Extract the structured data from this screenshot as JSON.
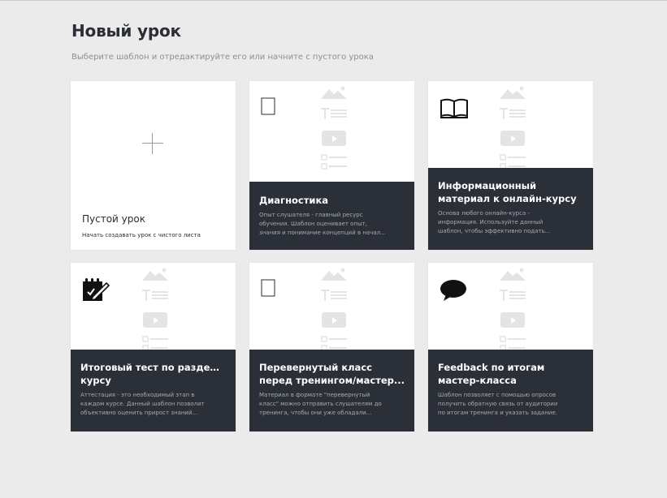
{
  "page": {
    "title": "Новый урок",
    "subtitle": "Выберите шаблон и отредактируйте его или начните с пустого урока"
  },
  "blank_card": {
    "title": "Пустой урок",
    "description": "Начать создавать урок с чистого листа",
    "icon": "plus-icon"
  },
  "templates": [
    {
      "title_lines": [
        "Диагностика"
      ],
      "description_lines": [
        "Опыт слушателя - главный ресурс",
        "обучения. Шаблон оценивает опыт,",
        "знания и понимание концепций в начал..."
      ],
      "icon": "blank-page-icon"
    },
    {
      "title_lines": [
        "Информационный",
        "материал к онлайн-курсу"
      ],
      "description_lines": [
        "Основа любого онлайн-курса -",
        "информация. Используйте данный",
        "шаблон, чтобы эффективно подать..."
      ],
      "icon": "open-book-icon"
    },
    {
      "title_lines": [
        "Итоговый тест по разделу/",
        "курсу"
      ],
      "description_lines": [
        "Аттестация - это необходимый этап в",
        "каждом курсе. Данный шаблон позволит",
        "объективно оценить прирост знаний..."
      ],
      "icon": "test-notepad-icon"
    },
    {
      "title_lines": [
        "Перевернутый класс",
        "перед тренингом/мастер..."
      ],
      "description_lines": [
        "Материал в формате \"перевернутый",
        "класс\" можно отправить слушателям до",
        "тренинга, чтобы они уже обладали..."
      ],
      "icon": "blank-page-icon"
    },
    {
      "title_lines": [
        "Feedback по итогам",
        "мастер-класса"
      ],
      "description_lines": [
        "Шаблон позволяет с помощью опросов",
        "получить обратную связь от аудитории",
        "по итогам тренинга и указать задание."
      ],
      "icon": "speech-bubble-icon"
    }
  ],
  "colors": {
    "background": "#ebebeb",
    "card": "#ffffff",
    "panel": "#2b2f37",
    "panel_text_muted": "#a6a9b0",
    "preview_gray": "#e3e4e6"
  }
}
